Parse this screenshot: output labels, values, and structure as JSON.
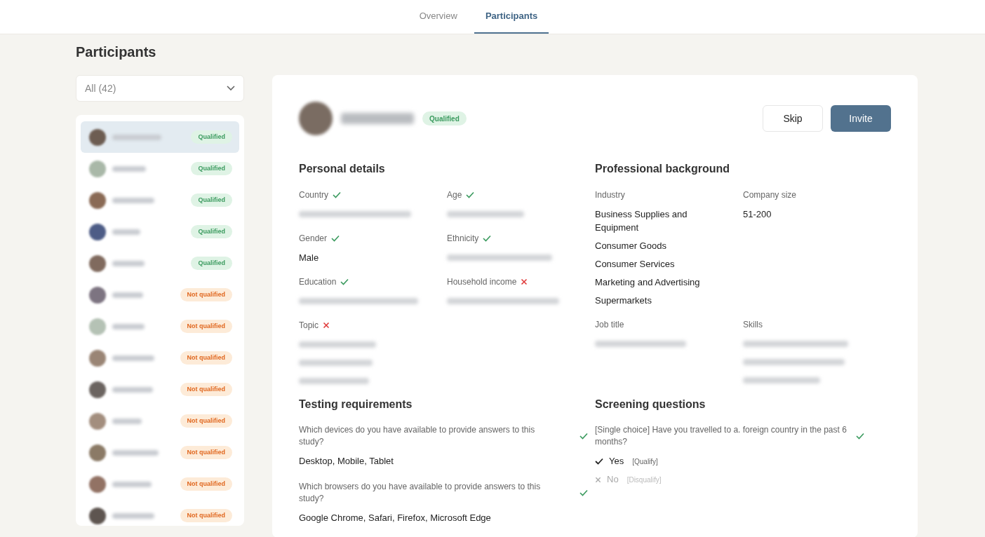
{
  "tabs": [
    {
      "label": "Overview",
      "selected": false
    },
    {
      "label": "Participants",
      "selected": true
    }
  ],
  "page_title": "Participants",
  "filter": {
    "value": "All (42)"
  },
  "participants": [
    {
      "status": "Qualified",
      "kind": "qualified",
      "selected": true
    },
    {
      "status": "Qualified",
      "kind": "qualified",
      "selected": false
    },
    {
      "status": "Qualified",
      "kind": "qualified",
      "selected": false
    },
    {
      "status": "Qualified",
      "kind": "qualified",
      "selected": false
    },
    {
      "status": "Qualified",
      "kind": "qualified",
      "selected": false
    },
    {
      "status": "Not qualified",
      "kind": "not_qualified",
      "selected": false
    },
    {
      "status": "Not qualified",
      "kind": "not_qualified",
      "selected": false
    },
    {
      "status": "Not qualified",
      "kind": "not_qualified",
      "selected": false
    },
    {
      "status": "Not qualified",
      "kind": "not_qualified",
      "selected": false
    },
    {
      "status": "Not qualified",
      "kind": "not_qualified",
      "selected": false
    },
    {
      "status": "Not qualified",
      "kind": "not_qualified",
      "selected": false
    },
    {
      "status": "Not qualified",
      "kind": "not_qualified",
      "selected": false
    },
    {
      "status": "Not qualified",
      "kind": "not_qualified",
      "selected": false
    }
  ],
  "profile": {
    "status": "Qualified",
    "kind": "qualified",
    "buttons": [
      {
        "label": "Skip",
        "kind": "secondary"
      },
      {
        "label": "Invite",
        "kind": "primary"
      }
    ]
  },
  "personal_details": {
    "title": "Personal details",
    "fields": [
      {
        "label": "Country",
        "match": true,
        "lines": [
          {
            "kind": "blurred"
          }
        ]
      },
      {
        "label": "Age",
        "match": true,
        "lines": [
          {
            "kind": "blurred"
          }
        ]
      },
      {
        "label": "Gender",
        "match": true,
        "lines": [
          {
            "kind": "text",
            "text": "Male"
          }
        ]
      },
      {
        "label": "Ethnicity",
        "match": true,
        "lines": [
          {
            "kind": "blurred"
          }
        ]
      },
      {
        "label": "Education",
        "match": true,
        "lines": [
          {
            "kind": "blurred"
          }
        ]
      },
      {
        "label": "Household income",
        "match": false,
        "lines": [
          {
            "kind": "blurred"
          }
        ]
      },
      {
        "label": "Topic",
        "match": false,
        "lines": [
          {
            "kind": "blurred"
          },
          {
            "kind": "blurred"
          },
          {
            "kind": "blurred"
          }
        ]
      }
    ]
  },
  "professional_background": {
    "title": "Professional background",
    "fields": [
      {
        "label": "Industry",
        "lines": [
          {
            "kind": "text",
            "text": "Business Supplies and Equipment"
          },
          {
            "kind": "text",
            "text": "Consumer Goods"
          },
          {
            "kind": "text",
            "text": "Consumer Services"
          },
          {
            "kind": "text",
            "text": "Marketing and Advertising"
          },
          {
            "kind": "text",
            "text": "Supermarkets"
          }
        ]
      },
      {
        "label": "Company size",
        "lines": [
          {
            "kind": "text",
            "text": "51-200"
          }
        ]
      },
      {
        "label": "Job title",
        "lines": [
          {
            "kind": "blurred"
          }
        ]
      },
      {
        "label": "Skills",
        "lines": [
          {
            "kind": "blurred"
          },
          {
            "kind": "blurred"
          },
          {
            "kind": "blurred"
          }
        ]
      }
    ]
  },
  "testing_requirements": {
    "title": "Testing requirements",
    "items": [
      {
        "question": "Which devices do you have available to provide answers to this study?",
        "match": true,
        "answer": "Desktop, Mobile, Tablet"
      },
      {
        "question": "Which browsers do you have available to provide answers to this study?",
        "match": true,
        "answer": "Google Chrome, Safari, Firefox, Microsoft Edge"
      }
    ]
  },
  "screening_questions": {
    "title": "Screening questions",
    "items": [
      {
        "question": "[Single choice] Have you travelled to a. foreign country in the past 6 months?",
        "match": true,
        "options": [
          {
            "label": "Yes",
            "rule": "[Qualify]",
            "selected": true
          },
          {
            "label": "No",
            "rule": "[Disqualify]",
            "selected": false
          }
        ]
      }
    ]
  }
}
